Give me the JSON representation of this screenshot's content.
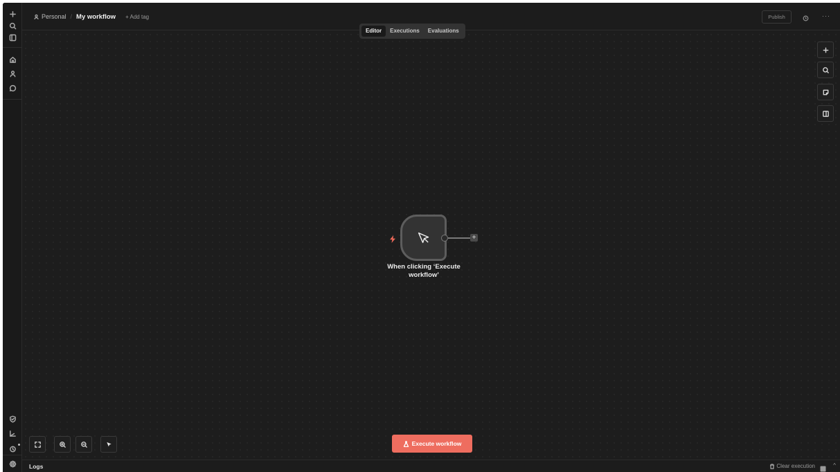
{
  "breadcrumb": {
    "project": "Personal",
    "workflow_title": "My workflow",
    "add_tag": "+ Add tag"
  },
  "tabs": [
    {
      "label": "Editor",
      "active": true
    },
    {
      "label": "Executions",
      "active": false
    },
    {
      "label": "Evaluations",
      "active": false
    }
  ],
  "header": {
    "publish_label": "Publish",
    "history_icon": "history-icon",
    "more_label": "···"
  },
  "left_rail": {
    "top_icons": [
      "plus-icon",
      "search-icon",
      "sidebar-toggle-icon"
    ],
    "nav_icons": [
      "home-icon",
      "user-icon",
      "chat-icon"
    ],
    "bottom_icons": [
      "shield-icon",
      "chart-icon",
      "help-icon",
      "settings-icon"
    ]
  },
  "canvas_tools": [
    "add-node-icon",
    "search-icon",
    "sticky-note-icon",
    "panel-icon"
  ],
  "node": {
    "label": "When clicking ‘Execute workflow’",
    "icon": "cursor-icon",
    "trigger_icon": "lightning-icon"
  },
  "zoom_tools": [
    "fit-view-icon",
    "zoom-in-icon",
    "zoom-out-icon",
    "cursor-tool-icon"
  ],
  "execute_button": {
    "label": "Execute workflow",
    "icon": "flask-icon"
  },
  "logs_bar": {
    "label": "Logs",
    "clear_label": "Clear execution"
  },
  "colors": {
    "accent": "#ee6d5f",
    "background": "#1d1d1d",
    "node_border": "#5d5d5d"
  }
}
